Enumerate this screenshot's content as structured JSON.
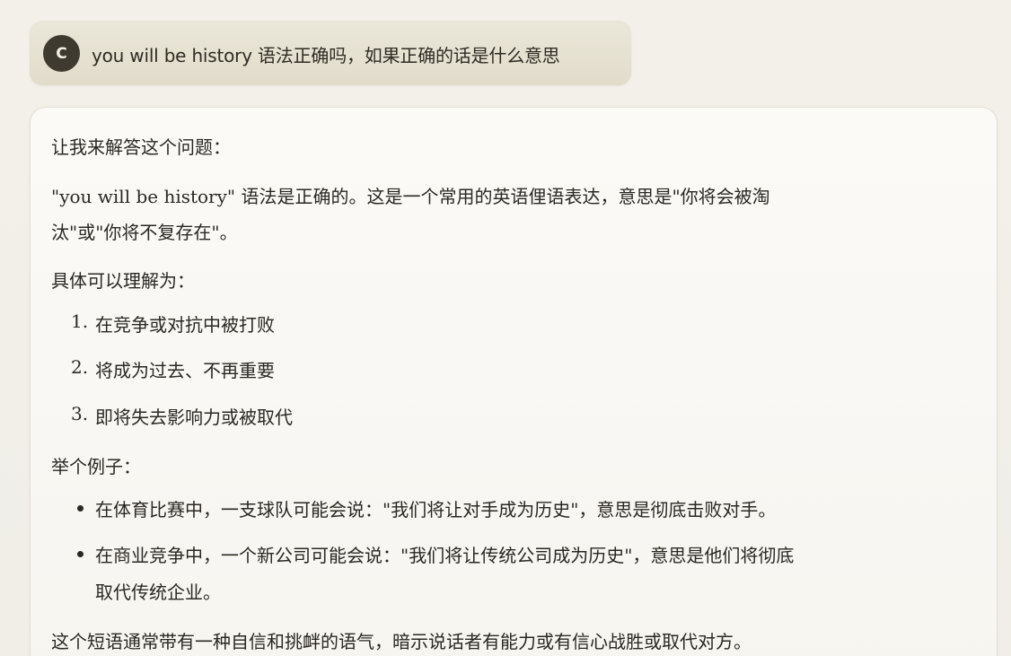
{
  "user_message": {
    "avatar_initial": "C",
    "text": "you will be history 语法正确吗，如果正确的话是什么意思"
  },
  "assistant_message": {
    "intro": "让我来解答这个问题：",
    "answer_line1": "\"you will be history\" 语法是正确的。这是一个常用的英语俚语表达，意思是\"你将会被淘",
    "answer_line2": "汰\"或\"你将不复存在\"。",
    "specific_heading": "具体可以理解为：",
    "numbered_items": [
      {
        "num": "1.",
        "text": "在竞争或对抗中被打败"
      },
      {
        "num": "2.",
        "text": "将成为过去、不再重要"
      },
      {
        "num": "3.",
        "text": "即将失去影响力或被取代"
      }
    ],
    "example_heading": "举个例子：",
    "example_items": [
      {
        "line1": "在体育比赛中，一支球队可能会说：\"我们将让对手成为历史\"，意思是彻底击败对手。",
        "line2": ""
      },
      {
        "line1": "在商业竞争中，一个新公司可能会说：\"我们将让传统公司成为历史\"，意思是他们将彻底",
        "line2": "取代传统企业。"
      }
    ],
    "conclusion": "这个短语通常带有一种自信和挑衅的语气，暗示说话者有能力或有信心战胜或取代对方。"
  },
  "colors": {
    "background": "#f1efe8",
    "user_bubble": "#e6e2d2",
    "avatar": "#3f3a2f",
    "assistant_card": "#faf9f5",
    "text": "#2b2822"
  }
}
